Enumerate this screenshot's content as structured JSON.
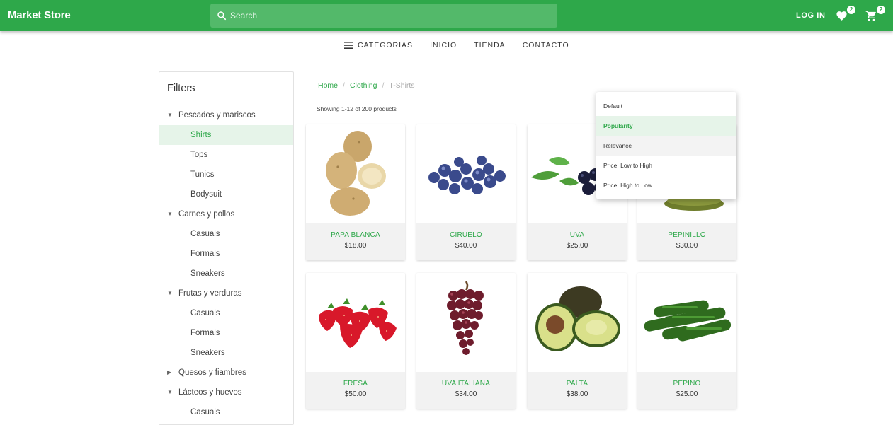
{
  "header": {
    "brand": "Market Store",
    "search_placeholder": "Search",
    "login_label": "LOG IN",
    "wishlist_count": "2",
    "cart_count": "2"
  },
  "nav": {
    "categories": "CATEGORIAS",
    "items": [
      "INICIO",
      "TIENDA",
      "CONTACTO"
    ]
  },
  "filters": {
    "title": "Filters",
    "rows": [
      {
        "label": "Pescados y mariscos",
        "kind": "group",
        "expanded": true
      },
      {
        "label": "Shirts",
        "kind": "sub",
        "active": true
      },
      {
        "label": "Tops",
        "kind": "sub"
      },
      {
        "label": "Tunics",
        "kind": "sub"
      },
      {
        "label": "Bodysuit",
        "kind": "sub"
      },
      {
        "label": "Carnes y pollos",
        "kind": "group",
        "expanded": true
      },
      {
        "label": "Casuals",
        "kind": "sub"
      },
      {
        "label": "Formals",
        "kind": "sub"
      },
      {
        "label": "Sneakers",
        "kind": "sub"
      },
      {
        "label": "Frutas y verduras",
        "kind": "group",
        "expanded": true
      },
      {
        "label": "Casuals",
        "kind": "sub"
      },
      {
        "label": "Formals",
        "kind": "sub"
      },
      {
        "label": "Sneakers",
        "kind": "sub"
      },
      {
        "label": "Quesos y fiambres",
        "kind": "group",
        "expanded": false
      },
      {
        "label": "Lácteos y huevos",
        "kind": "group",
        "expanded": true
      },
      {
        "label": "Casuals",
        "kind": "sub"
      }
    ]
  },
  "breadcrumb": {
    "home": "Home",
    "clothing": "Clothing",
    "current": "T-Shirts"
  },
  "results": {
    "showing": "Showing 1-12 of 200 products"
  },
  "sort_menu": {
    "options": [
      "Default",
      "Popularity",
      "Relevance",
      "Price: Low to High",
      "Price: High to Low"
    ],
    "selected": "Popularity"
  },
  "products": [
    {
      "name": "PAPA BLANCA",
      "price": "$18.00",
      "icon": "potato-image"
    },
    {
      "name": "CIRUELO",
      "price": "$40.00",
      "icon": "blueberries-image"
    },
    {
      "name": "UVA",
      "price": "$25.00",
      "icon": "grapes-leaf-image"
    },
    {
      "name": "PEPINILLO",
      "price": "$30.00",
      "icon": "gherkin-image"
    },
    {
      "name": "FRESA",
      "price": "$50.00",
      "icon": "strawberry-image"
    },
    {
      "name": "UVA ITALIANA",
      "price": "$34.00",
      "icon": "red-grapes-image"
    },
    {
      "name": "PALTA",
      "price": "$38.00",
      "icon": "avocado-image"
    },
    {
      "name": "PEPINO",
      "price": "$25.00",
      "icon": "cucumber-image"
    }
  ],
  "colors": {
    "brand_green": "#2ea84a",
    "active_bg": "#e6f4e9"
  }
}
